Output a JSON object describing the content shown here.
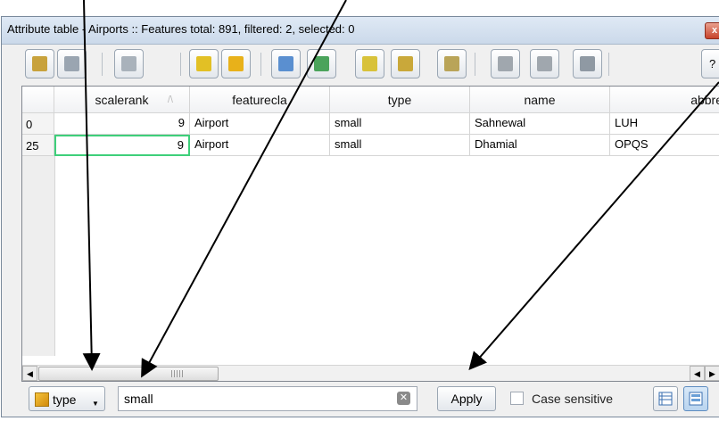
{
  "window": {
    "title": "Attribute table - Airports :: Features total: 891, filtered: 2, selected: 0",
    "close_label": "x"
  },
  "toolbar": {
    "buttons": [
      {
        "name": "toggle-editing",
        "icon": "pencil-icon",
        "color": "#c8a23c"
      },
      {
        "name": "save-edits",
        "icon": "save-icon",
        "color": "#9aa5b1"
      },
      {
        "name": "delete-selected",
        "icon": "delete-features-icon",
        "color": "#a9b2bb"
      },
      {
        "name": "select-by-expression",
        "icon": "expression-select-icon",
        "color": "#e2c025"
      },
      {
        "name": "unselect-all",
        "icon": "deselect-icon",
        "color": "#e8b11a"
      },
      {
        "name": "move-selection-to-top",
        "icon": "move-top-icon",
        "color": "#5a8fd0"
      },
      {
        "name": "invert-selection",
        "icon": "invert-selection-icon",
        "color": "#4aa35b"
      },
      {
        "name": "pan-to-selected",
        "icon": "pan-icon",
        "color": "#d8c23a"
      },
      {
        "name": "zoom-to-selected",
        "icon": "zoom-icon",
        "color": "#c9a83a"
      },
      {
        "name": "copy-selected",
        "icon": "copy-icon",
        "color": "#b9a458"
      },
      {
        "name": "delete-column",
        "icon": "delete-column-icon",
        "color": "#a0a7ae"
      },
      {
        "name": "new-column",
        "icon": "new-column-icon",
        "color": "#a0a7ae"
      },
      {
        "name": "field-calculator",
        "icon": "calculator-icon",
        "color": "#8f99a3"
      }
    ],
    "help_label": "?"
  },
  "table": {
    "columns": [
      "scalerank",
      "featurecla",
      "type",
      "name",
      "abbrev"
    ],
    "sort_indicator": "/\\",
    "rows": [
      {
        "id": "0",
        "cells": [
          "9",
          "Airport",
          "small",
          "Sahnewal",
          "LUH"
        ]
      },
      {
        "id": "25",
        "cells": [
          "9",
          "Airport",
          "small",
          "Dhamial",
          "OPQS"
        ]
      }
    ]
  },
  "filter": {
    "field_label": "type",
    "value": "small",
    "apply_label": "Apply",
    "case_sensitive_label": "Case sensitive",
    "case_sensitive_checked": false
  },
  "colors": {
    "focus_border": "#3ecf7a",
    "title_bar": "#cbd9ea"
  }
}
